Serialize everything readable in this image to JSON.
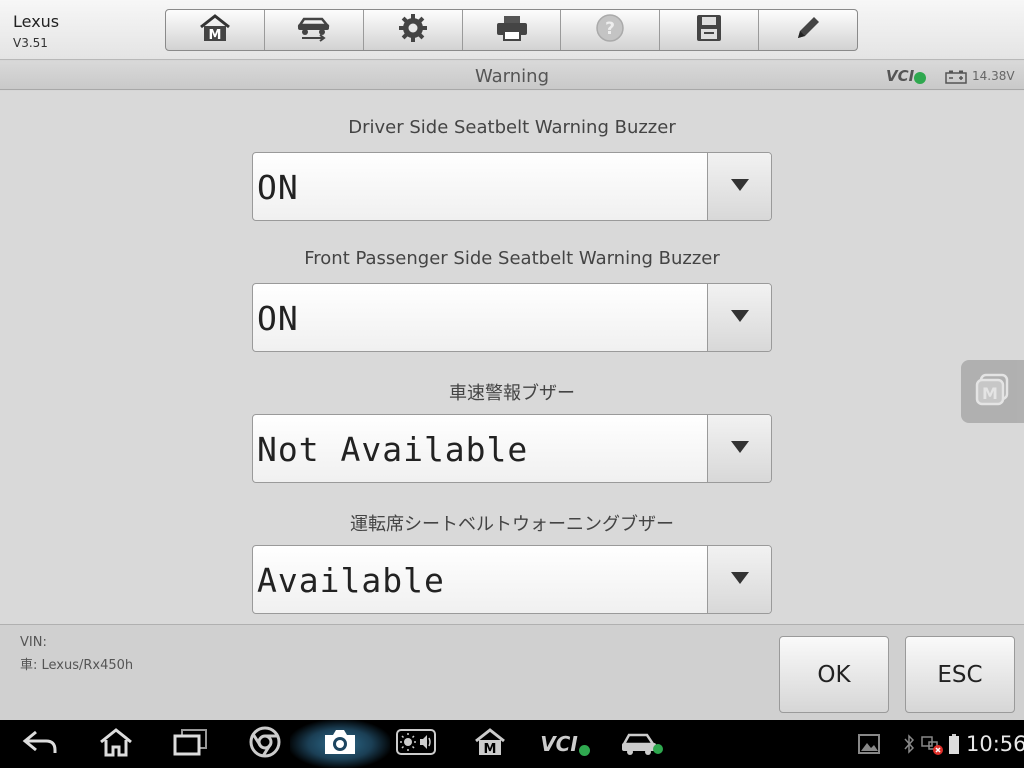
{
  "app": {
    "name": "Lexus",
    "version": "V3.51"
  },
  "toolbar": {
    "buttons": [
      {
        "icon": "home-m-icon"
      },
      {
        "icon": "vehicle-swap-icon"
      },
      {
        "icon": "gear-icon"
      },
      {
        "icon": "printer-icon"
      },
      {
        "icon": "help-icon"
      },
      {
        "icon": "save-icon"
      },
      {
        "icon": "pencil-icon"
      }
    ]
  },
  "subheader": {
    "title": "Warning",
    "vci": "VCI",
    "battery_voltage": "14.38V"
  },
  "fields": [
    {
      "label": "Driver Side Seatbelt Warning Buzzer",
      "value": "ON"
    },
    {
      "label": "Front Passenger Side Seatbelt Warning Buzzer",
      "value": "ON"
    },
    {
      "label": "車速警報ブザー",
      "value": "Not Available"
    },
    {
      "label": "運転席シートベルトウォーニングブザー",
      "value": "Available"
    }
  ],
  "footer": {
    "vin": "VIN:",
    "vehicle": "車: Lexus/Rx450h",
    "ok_label": "OK",
    "esc_label": "ESC"
  },
  "navbar": {
    "time": "10:56",
    "vci": "VCI"
  },
  "colors": {
    "status_ok": "#2fa84f",
    "alert": "#e0302a",
    "glow": "#2e6d8e"
  }
}
